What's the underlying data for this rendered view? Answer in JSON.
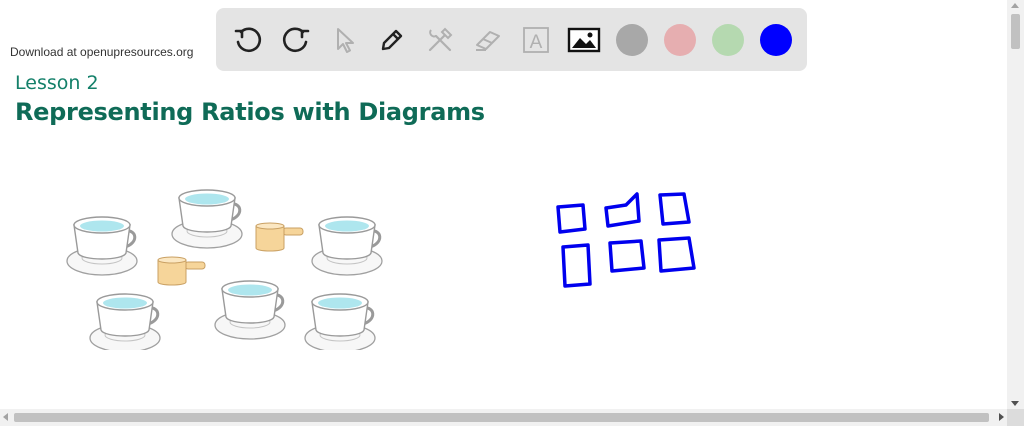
{
  "page": {
    "download_note": "Download at openupresources.org",
    "lesson_number": "Lesson 2",
    "lesson_title": "Representing Ratios with Diagrams"
  },
  "toolbar": {
    "tools": [
      {
        "icon": "undo-icon",
        "enabled": true
      },
      {
        "icon": "redo-icon",
        "enabled": true
      },
      {
        "icon": "select-pointer-icon",
        "enabled": false
      },
      {
        "icon": "pen-icon",
        "enabled": true
      },
      {
        "icon": "tools-icon",
        "enabled": false
      },
      {
        "icon": "eraser-icon",
        "enabled": false
      },
      {
        "icon": "text-icon",
        "enabled": false,
        "glyph": "A"
      },
      {
        "icon": "image-icon",
        "enabled": true
      }
    ],
    "colors": [
      "#a8a8a8",
      "#e6aeb0",
      "#b5d9b0",
      "#0000ff"
    ],
    "active_color": "#0000ff"
  },
  "illustration": {
    "cups_count": 6,
    "scoops_count": 2
  }
}
